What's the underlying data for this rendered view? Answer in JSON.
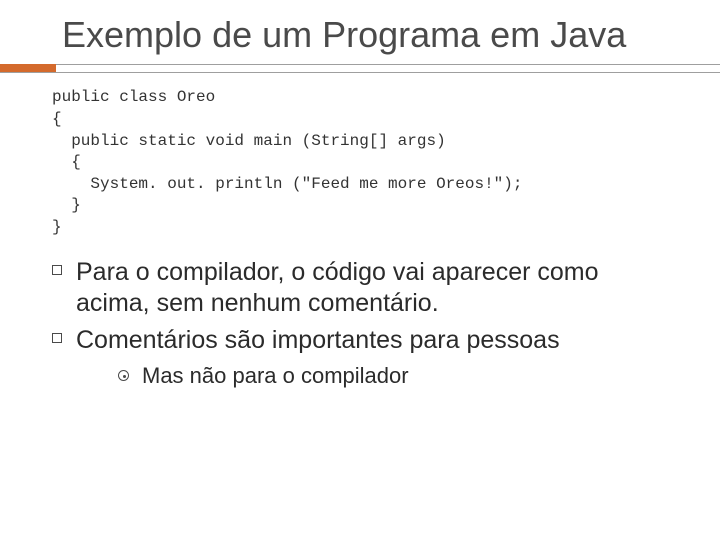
{
  "title": "Exemplo de um Programa em Java",
  "code": "public class Oreo\n{\n  public static void main (String[] args)\n  {\n    System. out. println (\"Feed me more Oreos!\");\n  }\n}",
  "bullets": [
    "Para o compilador, o código vai aparecer como acima, sem nenhum comentário.",
    "Comentários são importantes para pessoas"
  ],
  "sub_bullet": "Mas não para o compilador"
}
